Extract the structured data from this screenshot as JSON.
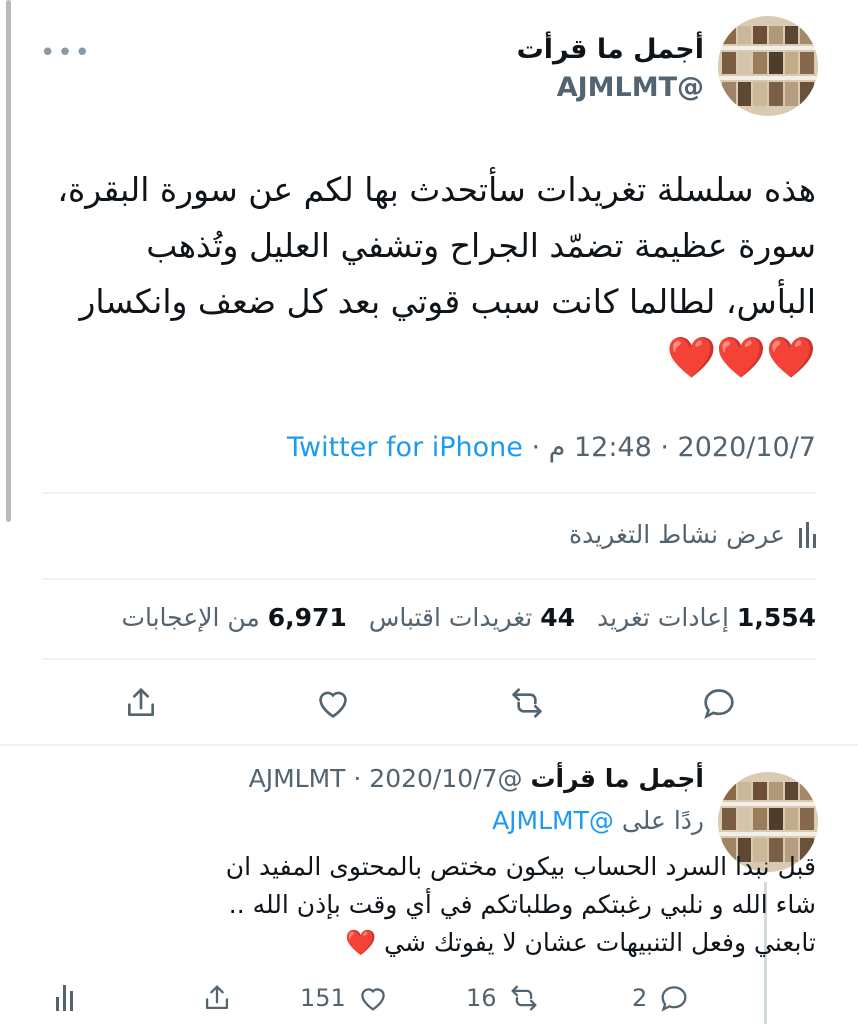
{
  "tweet": {
    "author_name": "أجمل ما قرأت",
    "author_handle": "@AJMLMT",
    "text_lines": [
      "هذه سلسلة تغريدات سأتحدث بها لكم عن سورة البقرة،",
      "سورة عظيمة تضمّد الجراح وتشفي العليل وتُذهب",
      "البأس، لطالما كانت سبب قوتي بعد كل ضعف وانكسار"
    ],
    "hearts": "❤️❤️❤️",
    "date": "2020/10/7",
    "time": "12:48 م",
    "source": "Twitter for iPhone",
    "activity_label": "عرض نشاط التغريدة",
    "stats": {
      "retweets_count": "1,554",
      "retweets_label": "إعادات تغريد",
      "quotes_count": "44",
      "quotes_label": "تغريدات اقتباس",
      "likes_count": "6,971",
      "likes_label": "من الإعجابات"
    }
  },
  "reply": {
    "author_name": "أجمل ما قرأت",
    "author_handle": "@AJMLMT",
    "date": "2020/10/7",
    "replying_to_label": "ردًا على",
    "replying_to_handle": "@AJMLMT",
    "text_lines": [
      "قبل نبدا السرد الحساب بيكون مختص بالمحتوى المفيد ان",
      "شاء الله و نلبي رغبتكم وطلباتكم في أي وقت بإذن الله ..",
      "تابعني وفعل التنبيهات عشان لا يفوتك شي"
    ],
    "heart": "❤️",
    "counts": {
      "replies": "2",
      "retweets": "16",
      "likes": "151"
    }
  },
  "colors": {
    "link": "#1d9bf0",
    "heart": "#d40f1f",
    "muted": "#536471"
  },
  "icons": [
    "more-icon",
    "reply-icon",
    "retweet-icon",
    "like-icon",
    "share-icon",
    "analytics-icon"
  ]
}
